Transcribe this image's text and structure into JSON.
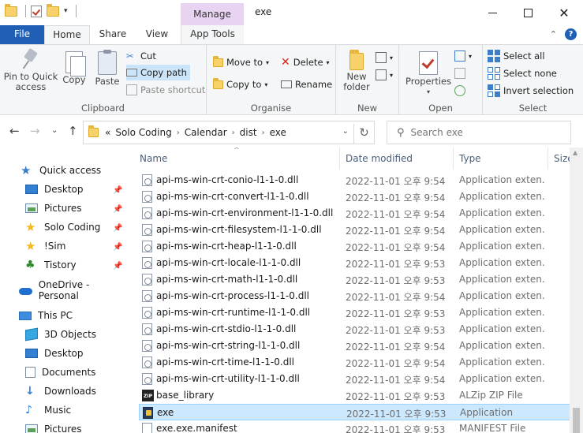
{
  "titlebar": {
    "manage_label": "Manage",
    "title": "exe"
  },
  "tabs": {
    "file": "File",
    "home": "Home",
    "share": "Share",
    "view": "View",
    "app_tools": "App Tools"
  },
  "ribbon": {
    "clipboard": {
      "group_label": "Clipboard",
      "pin_label": "Pin to Quick access",
      "copy_label": "Copy",
      "paste_label": "Paste",
      "cut_label": "Cut",
      "copy_path_label": "Copy path",
      "paste_shortcut_label": "Paste shortcut"
    },
    "organise": {
      "group_label": "Organise",
      "move_to_label": "Move to",
      "copy_to_label": "Copy to",
      "delete_label": "Delete",
      "rename_label": "Rename"
    },
    "new": {
      "group_label": "New",
      "new_folder_label": "New folder"
    },
    "open": {
      "group_label": "Open",
      "properties_label": "Properties"
    },
    "select": {
      "group_label": "Select",
      "select_all_label": "Select all",
      "select_none_label": "Select none",
      "invert_label": "Invert selection"
    }
  },
  "address": {
    "prefix": "«",
    "crumbs": [
      "Solo Coding",
      "Calendar",
      "dist",
      "exe"
    ]
  },
  "search": {
    "placeholder": "Search exe"
  },
  "nav": {
    "quick_access": "Quick access",
    "items": [
      "Desktop",
      "Pictures",
      "Solo Coding",
      "!Sim",
      "Tistory"
    ],
    "onedrive": "OneDrive - Personal",
    "this_pc": "This PC",
    "pc_items": [
      "3D Objects",
      "Desktop",
      "Documents",
      "Downloads",
      "Music",
      "Pictures"
    ]
  },
  "columns": {
    "name": "Name",
    "date": "Date modified",
    "type": "Type",
    "size": "Size"
  },
  "files": [
    {
      "name": "api-ms-win-crt-conio-l1-1-0.dll",
      "date": "2022-11-01 오후 9:54",
      "type": "Application exten...",
      "icon": "dll"
    },
    {
      "name": "api-ms-win-crt-convert-l1-1-0.dll",
      "date": "2022-11-01 오후 9:54",
      "type": "Application exten...",
      "icon": "dll"
    },
    {
      "name": "api-ms-win-crt-environment-l1-1-0.dll",
      "date": "2022-11-01 오후 9:54",
      "type": "Application exten...",
      "icon": "dll"
    },
    {
      "name": "api-ms-win-crt-filesystem-l1-1-0.dll",
      "date": "2022-11-01 오후 9:54",
      "type": "Application exten...",
      "icon": "dll"
    },
    {
      "name": "api-ms-win-crt-heap-l1-1-0.dll",
      "date": "2022-11-01 오후 9:54",
      "type": "Application exten...",
      "icon": "dll"
    },
    {
      "name": "api-ms-win-crt-locale-l1-1-0.dll",
      "date": "2022-11-01 오후 9:53",
      "type": "Application exten...",
      "icon": "dll"
    },
    {
      "name": "api-ms-win-crt-math-l1-1-0.dll",
      "date": "2022-11-01 오후 9:53",
      "type": "Application exten...",
      "icon": "dll"
    },
    {
      "name": "api-ms-win-crt-process-l1-1-0.dll",
      "date": "2022-11-01 오후 9:54",
      "type": "Application exten...",
      "icon": "dll"
    },
    {
      "name": "api-ms-win-crt-runtime-l1-1-0.dll",
      "date": "2022-11-01 오후 9:53",
      "type": "Application exten...",
      "icon": "dll"
    },
    {
      "name": "api-ms-win-crt-stdio-l1-1-0.dll",
      "date": "2022-11-01 오후 9:53",
      "type": "Application exten...",
      "icon": "dll"
    },
    {
      "name": "api-ms-win-crt-string-l1-1-0.dll",
      "date": "2022-11-01 오후 9:54",
      "type": "Application exten...",
      "icon": "dll"
    },
    {
      "name": "api-ms-win-crt-time-l1-1-0.dll",
      "date": "2022-11-01 오후 9:54",
      "type": "Application exten...",
      "icon": "dll"
    },
    {
      "name": "api-ms-win-crt-utility-l1-1-0.dll",
      "date": "2022-11-01 오후 9:54",
      "type": "Application exten...",
      "icon": "dll"
    },
    {
      "name": "base_library",
      "date": "2022-11-01 오후 9:53",
      "type": "ALZip ZIP File",
      "icon": "zip"
    },
    {
      "name": "exe",
      "date": "2022-11-01 오후 9:53",
      "type": "Application",
      "icon": "exe",
      "selected": true
    },
    {
      "name": "exe.exe.manifest",
      "date": "2022-11-01 오후 9:53",
      "type": "MANIFEST File",
      "icon": "manifest"
    }
  ],
  "colors": {
    "file_tab": "#1f5fb4",
    "manage_tab": "#e8d4f2",
    "selection": "#cce8ff"
  }
}
